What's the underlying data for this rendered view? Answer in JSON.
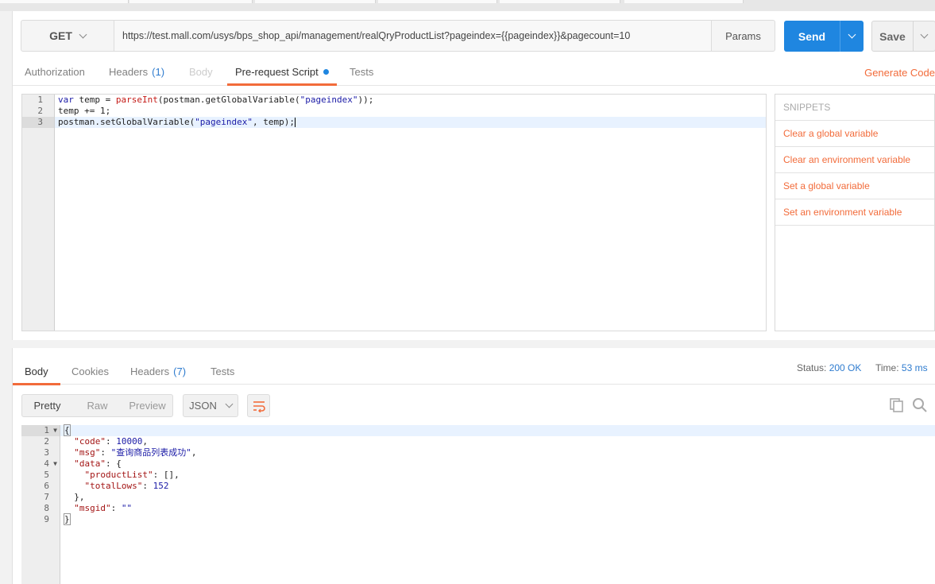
{
  "request": {
    "method": "GET",
    "url": "https://test.mall.com/usys/bps_shop_api/management/realQryProductList?pageindex={{pageindex}}&pagecount=10",
    "params_label": "Params",
    "send_label": "Send",
    "save_label": "Save",
    "tabs": [
      {
        "label": "Authorization"
      },
      {
        "label": "Headers",
        "count": "(1)"
      },
      {
        "label": "Body"
      },
      {
        "label": "Pre-request Script"
      },
      {
        "label": "Tests"
      }
    ],
    "generate_code_label": "Generate Code",
    "script_lines": [
      "1",
      "2",
      "3"
    ]
  },
  "snippets": {
    "header": "SNIPPETS",
    "items": [
      "Clear a global variable",
      "Clear an environment variable",
      "Set a global variable",
      "Set an environment variable"
    ]
  },
  "response": {
    "tabs": [
      {
        "label": "Body"
      },
      {
        "label": "Cookies"
      },
      {
        "label": "Headers",
        "count": "(7)"
      },
      {
        "label": "Tests"
      }
    ],
    "status_label": "Status:",
    "status_value": "200 OK",
    "time_label": "Time:",
    "time_value": "53 ms",
    "view_modes": [
      "Pretty",
      "Raw",
      "Preview"
    ],
    "format": "JSON",
    "line_numbers": [
      "1",
      "2",
      "3",
      "4",
      "5",
      "6",
      "7",
      "8",
      "9"
    ]
  },
  "icons": {
    "wrap": "wrap-lines-icon",
    "copy": "copy-icon",
    "search": "search-icon"
  },
  "colors": {
    "accent": "#f26b3a",
    "send": "#1f86e0"
  }
}
